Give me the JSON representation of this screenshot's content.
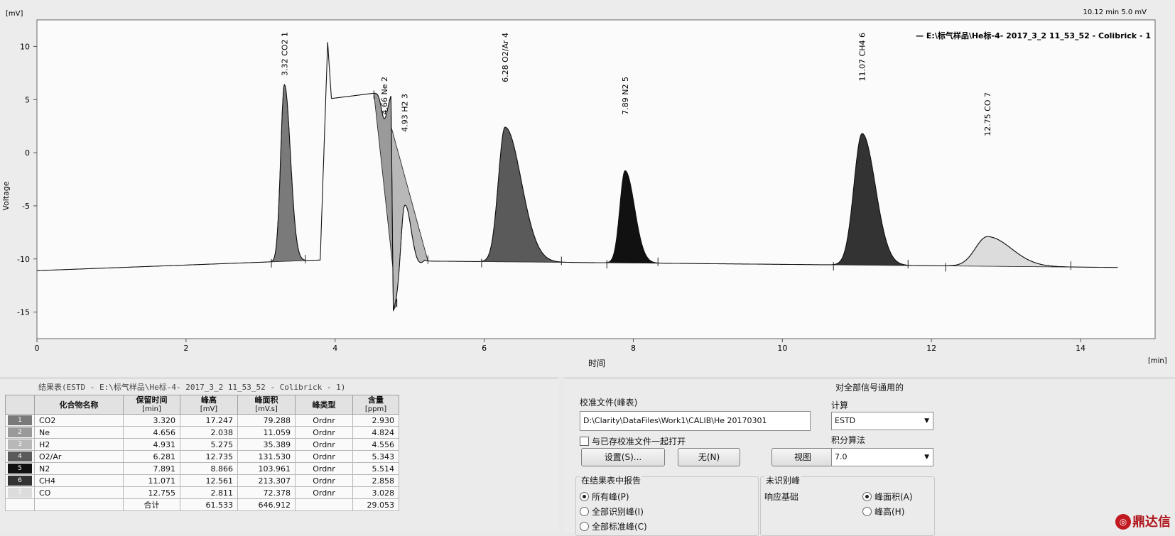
{
  "chart": {
    "status": "10.12 min  5.0 mV",
    "y_unit": "[mV]",
    "x_unit": "[min]",
    "ylabel": "Voltage",
    "xlabel": "时间",
    "legend": "— E:\\标气样品\\He标-4- 2017_3_2 11_53_52 - Colibrick - 1",
    "peak_labels": [
      "3.32 CO2   1",
      "4.66 Ne   2",
      "4.93 H2   3",
      "6.28 O2/Ar   4",
      "7.89 N2   5",
      "11.07 CH4   6",
      "12.75 CO   7"
    ]
  },
  "chart_data": {
    "type": "line",
    "xlim": [
      0,
      15
    ],
    "ylim": [
      -17.5,
      12.5
    ],
    "xticks": [
      0,
      2,
      4,
      6,
      8,
      10,
      12,
      14
    ],
    "yticks": [
      -15,
      -10,
      -5,
      0,
      5,
      10
    ],
    "grid": false,
    "legend_position": "top-right",
    "series": [
      {
        "name": "E:\\标气样品\\He标-4- 2017_3_2 11_53_52 - Colibrick - 1"
      }
    ],
    "peaks": [
      {
        "rt": 3.32,
        "apex_mv": 6.4,
        "compound": "CO2",
        "no": 1
      },
      {
        "rt": 4.66,
        "apex_mv": 3.2,
        "compound": "Ne",
        "no": 2
      },
      {
        "rt": 4.93,
        "apex_mv": -5.0,
        "compound": "H2",
        "no": 3
      },
      {
        "rt": 6.28,
        "apex_mv": 2.4,
        "compound": "O2/Ar",
        "no": 4
      },
      {
        "rt": 7.89,
        "apex_mv": -1.7,
        "compound": "N2",
        "no": 5
      },
      {
        "rt": 11.07,
        "apex_mv": 1.8,
        "compound": "CH4",
        "no": 6
      },
      {
        "rt": 12.75,
        "apex_mv": -7.9,
        "compound": "CO",
        "no": 7
      }
    ],
    "baseline_mv": [
      [
        0,
        -11.1
      ],
      [
        3.8,
        -10.1
      ],
      [
        3.9,
        10.4
      ],
      [
        3.95,
        5.1
      ],
      [
        4.75,
        5.8
      ],
      [
        4.78,
        -14.8
      ],
      [
        5.2,
        -10.2
      ],
      [
        14.5,
        -10.8
      ]
    ]
  },
  "results": {
    "title": "结果表(ESTD - E:\\标气样品\\He标-4- 2017_3_2 11_53_52 - Colibrick - 1)",
    "headers": [
      {
        "l1": "化合物名称",
        "l2": ""
      },
      {
        "l1": "保留时间",
        "l2": "[min]"
      },
      {
        "l1": "峰高",
        "l2": "[mV]"
      },
      {
        "l1": "峰面积",
        "l2": "[mV.s]"
      },
      {
        "l1": "峰类型",
        "l2": ""
      },
      {
        "l1": "含量",
        "l2": "[ppm]"
      }
    ],
    "rows": [
      {
        "idx": "1",
        "swatch": "#7a7a7a",
        "name": "CO2",
        "rt": "3.320",
        "height": "17.247",
        "area": "79.288",
        "type": "Ordnr",
        "amount": "2.930"
      },
      {
        "idx": "2",
        "swatch": "#9a9a9a",
        "name": "Ne",
        "rt": "4.656",
        "height": "2.038",
        "area": "11.059",
        "type": "Ordnr",
        "amount": "4.824"
      },
      {
        "idx": "3",
        "swatch": "#b8b8b8",
        "name": "H2",
        "rt": "4.931",
        "height": "5.275",
        "area": "35.389",
        "type": "Ordnr",
        "amount": "4.556"
      },
      {
        "idx": "4",
        "swatch": "#5a5a5a",
        "name": "O2/Ar",
        "rt": "6.281",
        "height": "12.735",
        "area": "131.530",
        "type": "Ordnr",
        "amount": "5.343"
      },
      {
        "idx": "5",
        "swatch": "#111111",
        "name": "N2",
        "rt": "7.891",
        "height": "8.866",
        "area": "103.961",
        "type": "Ordnr",
        "amount": "5.514"
      },
      {
        "idx": "6",
        "swatch": "#333333",
        "name": "CH4",
        "rt": "11.071",
        "height": "12.561",
        "area": "213.307",
        "type": "Ordnr",
        "amount": "2.858"
      },
      {
        "idx": "7",
        "swatch": "#dcdcdc",
        "name": "CO",
        "rt": "12.755",
        "height": "2.811",
        "area": "72.378",
        "type": "Ordnr",
        "amount": "3.028"
      }
    ],
    "total": {
      "label": "合计",
      "height": "61.533",
      "area": "646.912",
      "amount": "29.053"
    }
  },
  "calib": {
    "title": "对全部信号通用的",
    "file_label": "校准文件(峰表)",
    "file_value": "D:\\Clarity\\DataFiles\\Work1\\CALIB\\He 20170301",
    "open_with": "与已存校准文件一起打开",
    "btn_setup": "设置(S)...",
    "btn_none": "无(N)",
    "btn_view": "视图",
    "calc_label": "计算",
    "calc_value": "ESTD",
    "integ_label": "积分算法",
    "integ_value": "7.0",
    "report_title": "在结果表中报告",
    "report_opts": [
      "所有峰(P)",
      "全部识别峰(I)",
      "全部标准峰(C)"
    ],
    "unid_title": "未识别峰",
    "response_label": "响应基础",
    "response_opts": [
      "峰面积(A)",
      "峰高(H)"
    ],
    "logo": "鼎达信"
  }
}
